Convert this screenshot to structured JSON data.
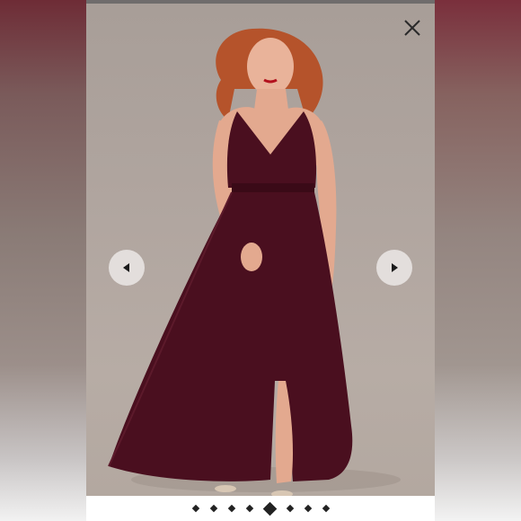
{
  "viewer": {
    "close_icon": "close-icon",
    "prev_icon": "chevron-left-icon",
    "next_icon": "chevron-right-icon",
    "slide_count": 8,
    "active_slide": 4
  },
  "colors": {
    "dress": "#4a0f1f",
    "backdrop": "#b0a59f",
    "hair": "#b5532b"
  }
}
